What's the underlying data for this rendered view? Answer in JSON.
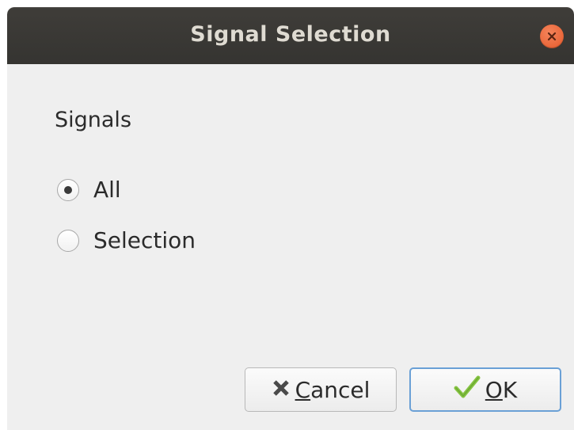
{
  "window": {
    "title": "Signal Selection"
  },
  "group": {
    "label": "Signals"
  },
  "options": [
    {
      "label": "All",
      "selected": true
    },
    {
      "label": "Selection",
      "selected": false
    }
  ],
  "buttons": {
    "cancel": {
      "mnemonic": "C",
      "rest": "ancel",
      "icon": "x-icon"
    },
    "ok": {
      "mnemonic": "O",
      "rest": "K",
      "icon": "checkmark-icon"
    }
  },
  "colors": {
    "titlebar": "#3c3b37",
    "close": "#e95f2f",
    "ok_border": "#6aa0d6",
    "check_green": "#7fbf3a"
  }
}
